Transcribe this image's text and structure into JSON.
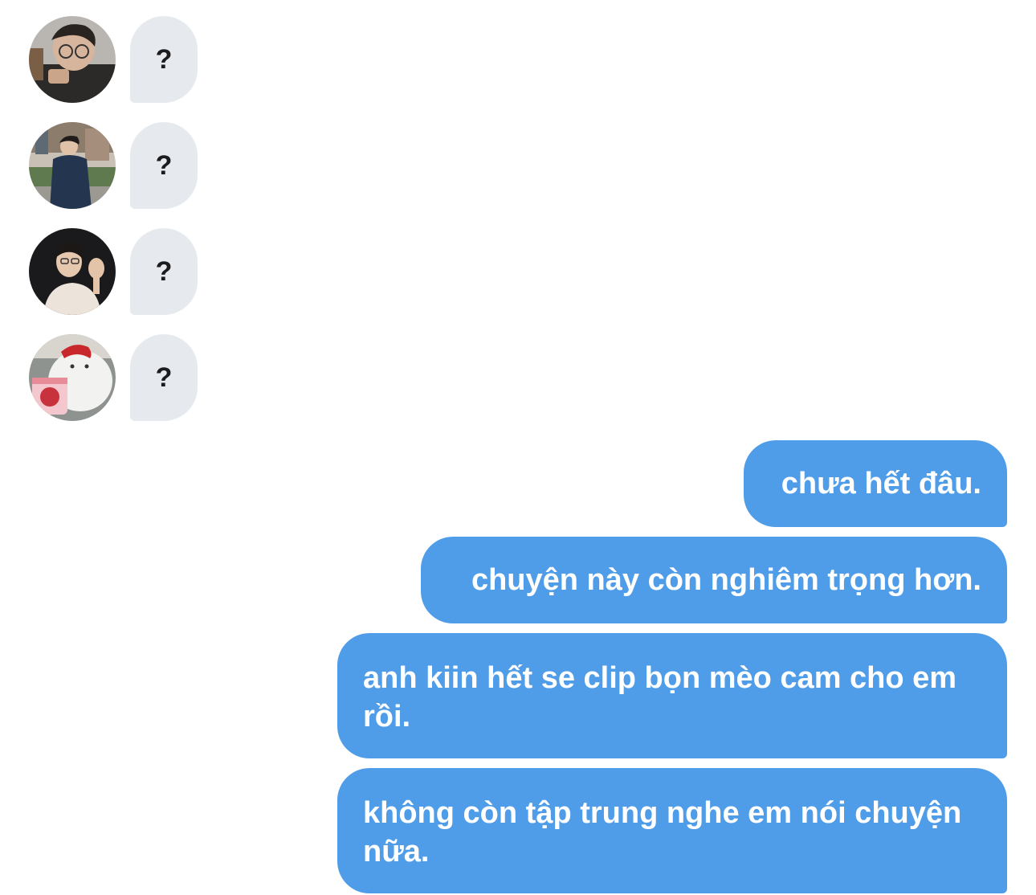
{
  "incoming": [
    {
      "avatar": "avatar-man-glasses-icon",
      "text": "?"
    },
    {
      "avatar": "avatar-man-street-icon",
      "text": "?"
    },
    {
      "avatar": "avatar-man-waving-icon",
      "text": "?"
    },
    {
      "avatar": "avatar-cartoon-bear-icon",
      "text": "?"
    }
  ],
  "outgoing": [
    {
      "text": "chưa hết đâu."
    },
    {
      "text": "chuyện này còn nghiêm trọng hơn."
    },
    {
      "text": "anh kiin hết se clip bọn mèo cam cho em rồi."
    },
    {
      "text": "không còn tập trung nghe em nói chuyện nữa."
    }
  ],
  "colors": {
    "incoming_bubble": "#e6e9ee",
    "outgoing_bubble": "#4f9de8",
    "outgoing_text": "#ffffff",
    "incoming_text": "#1c1c1e"
  }
}
